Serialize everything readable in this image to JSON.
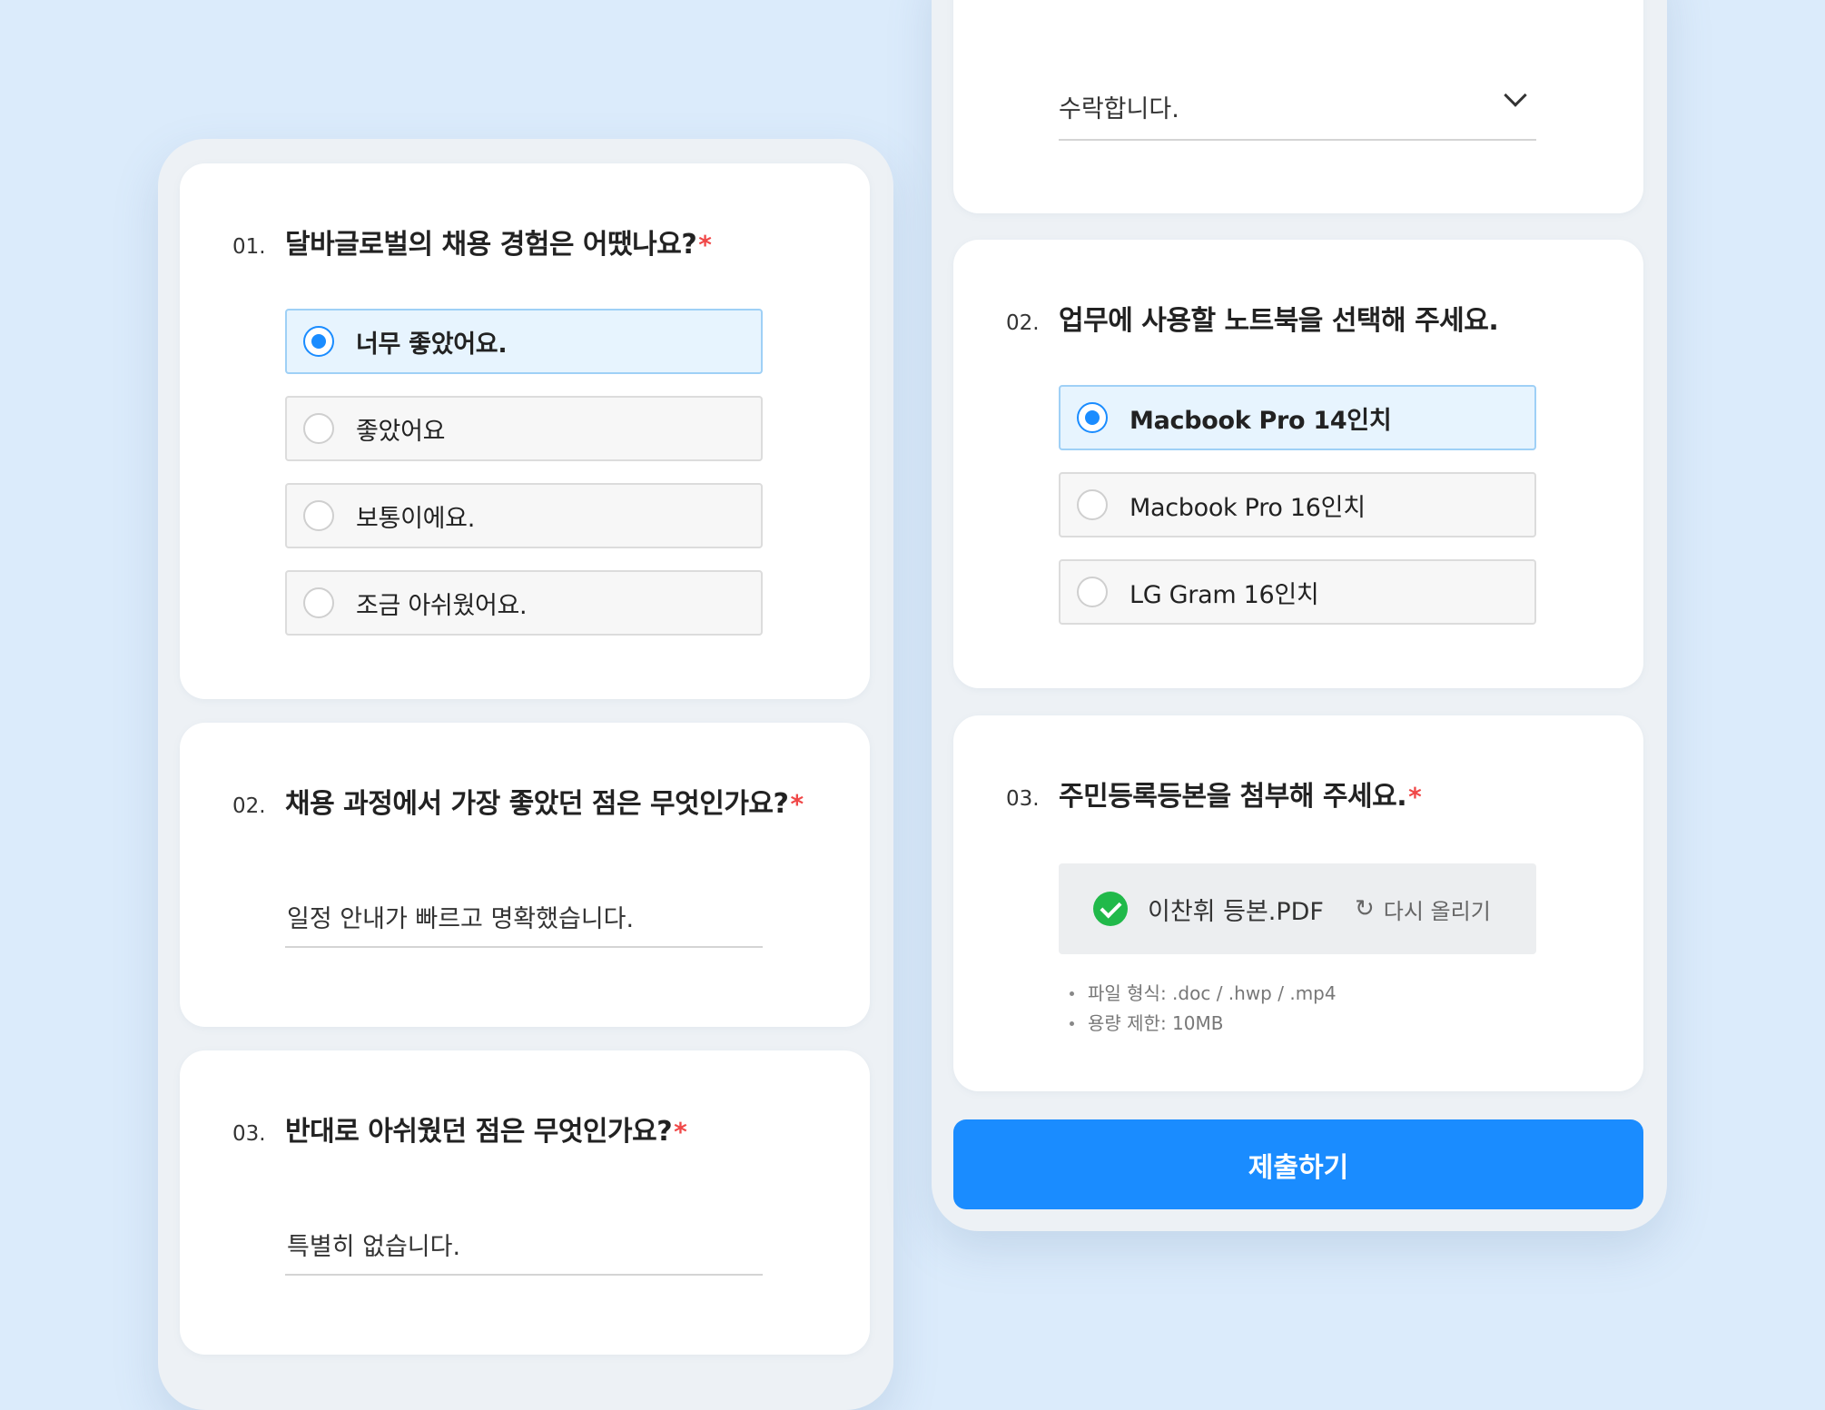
{
  "left_form": {
    "q1": {
      "number": "01.",
      "title": "달바글로벌의 채용 경험은 어땠나요?",
      "required_mark": "*",
      "options": [
        "너무 좋았어요.",
        "좋았어요",
        "보통이에요.",
        "조금 아쉬웠어요."
      ],
      "selected_index": 0
    },
    "q2": {
      "number": "02.",
      "title": "채용 과정에서 가장 좋았던 점은 무엇인가요?",
      "required_mark": "*",
      "answer": "일정 안내가 빠르고 명확했습니다."
    },
    "q3": {
      "number": "03.",
      "title": "반대로 아쉬웠던 점은 무엇인가요?",
      "required_mark": "*",
      "answer": "특별히 없습니다."
    }
  },
  "right_form": {
    "consent_select": {
      "value": "수락합니다.",
      "icon": "chevron-down-icon"
    },
    "q2": {
      "number": "02.",
      "title": "업무에 사용할 노트북을 선택해 주세요.",
      "options": [
        "Macbook Pro 14인치",
        "Macbook Pro 16인치",
        "LG Gram 16인치"
      ],
      "selected_index": 0
    },
    "q3": {
      "number": "03.",
      "title": "주민등록등본을 첨부해 주세요.",
      "required_mark": "*",
      "file_name": "이찬휘 등본.PDF",
      "reupload_label": "다시 올리기",
      "hints": [
        "파일 형식: .doc / .hwp / .mp4",
        "용량 제한: 10MB"
      ]
    },
    "submit_label": "제출하기"
  },
  "colors": {
    "accent": "#1a8cff",
    "required": "#f04848",
    "success": "#21b94a",
    "background": "#dbebfb"
  }
}
